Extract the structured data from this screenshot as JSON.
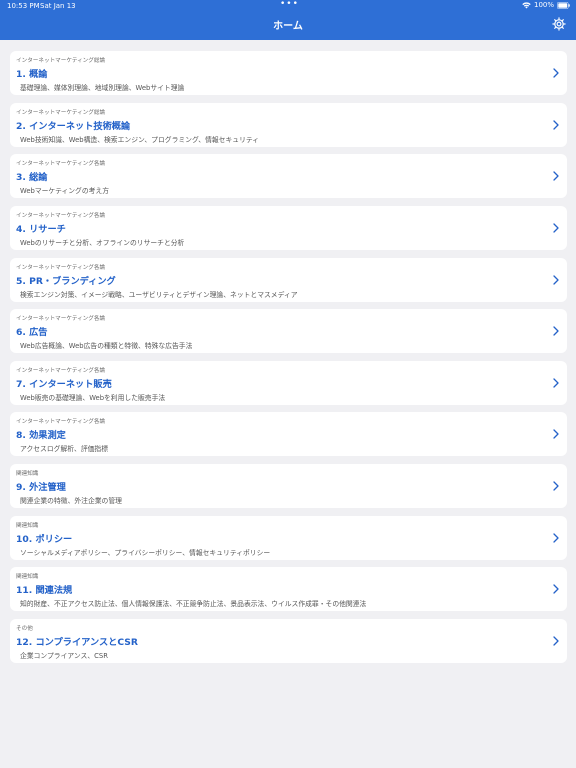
{
  "status_bar": {
    "time": "10:53 PM",
    "date": "Sat Jan 13",
    "dots": "•••",
    "battery": "100%"
  },
  "nav": {
    "title": "ホーム"
  },
  "colors": {
    "header": "#2e6fd6",
    "accent": "#2462c9",
    "background": "#f0f0f3"
  },
  "items": [
    {
      "category": "インターネットマーケティング総論",
      "title": "1. 概論",
      "description": "基礎理論、媒体別理論、地域別理論、Webサイト理論"
    },
    {
      "category": "インターネットマーケティング総論",
      "title": "2. インターネット技術概論",
      "description": "Web技術知識、Web構造、検索エンジン、プログラミング、情報セキュリティ"
    },
    {
      "category": "インターネットマーケティング各論",
      "title": "3. 総論",
      "description": "Webマーケティングの考え方"
    },
    {
      "category": "インターネットマーケティング各論",
      "title": "4. リサーチ",
      "description": "Webのリサーチと分析、オフラインのリサーチと分析"
    },
    {
      "category": "インターネットマーケティング各論",
      "title": "5. PR・ブランディング",
      "description": "検索エンジン対策、イメージ戦略、ユーザビリティとデザイン理論、ネットとマスメディア"
    },
    {
      "category": "インターネットマーケティング各論",
      "title": "6. 広告",
      "description": "Web広告概論、Web広告の種類と特徴、特殊な広告手法"
    },
    {
      "category": "インターネットマーケティング各論",
      "title": "7. インターネット販売",
      "description": "Web販売の基礎理論、Webを利用した販売手法"
    },
    {
      "category": "インターネットマーケティング各論",
      "title": "8. 効果測定",
      "description": "アクセスログ解析、評価指標"
    },
    {
      "category": "関連知識",
      "title": "9. 外注管理",
      "description": "関連企業の特徴、外注企業の管理"
    },
    {
      "category": "関連知識",
      "title": "10. ポリシー",
      "description": "ソーシャルメディアポリシー、プライバシーポリシー、情報セキュリティポリシー"
    },
    {
      "category": "関連知識",
      "title": "11. 関連法規",
      "description": "知的財産、不正アクセス防止法、個人情報保護法、不正競争防止法、景品表示法、ウイルス作成罪・その他関連法"
    },
    {
      "category": "その他",
      "title": "12. コンプライアンスとCSR",
      "description": "企業コンプライアンス、CSR"
    }
  ]
}
